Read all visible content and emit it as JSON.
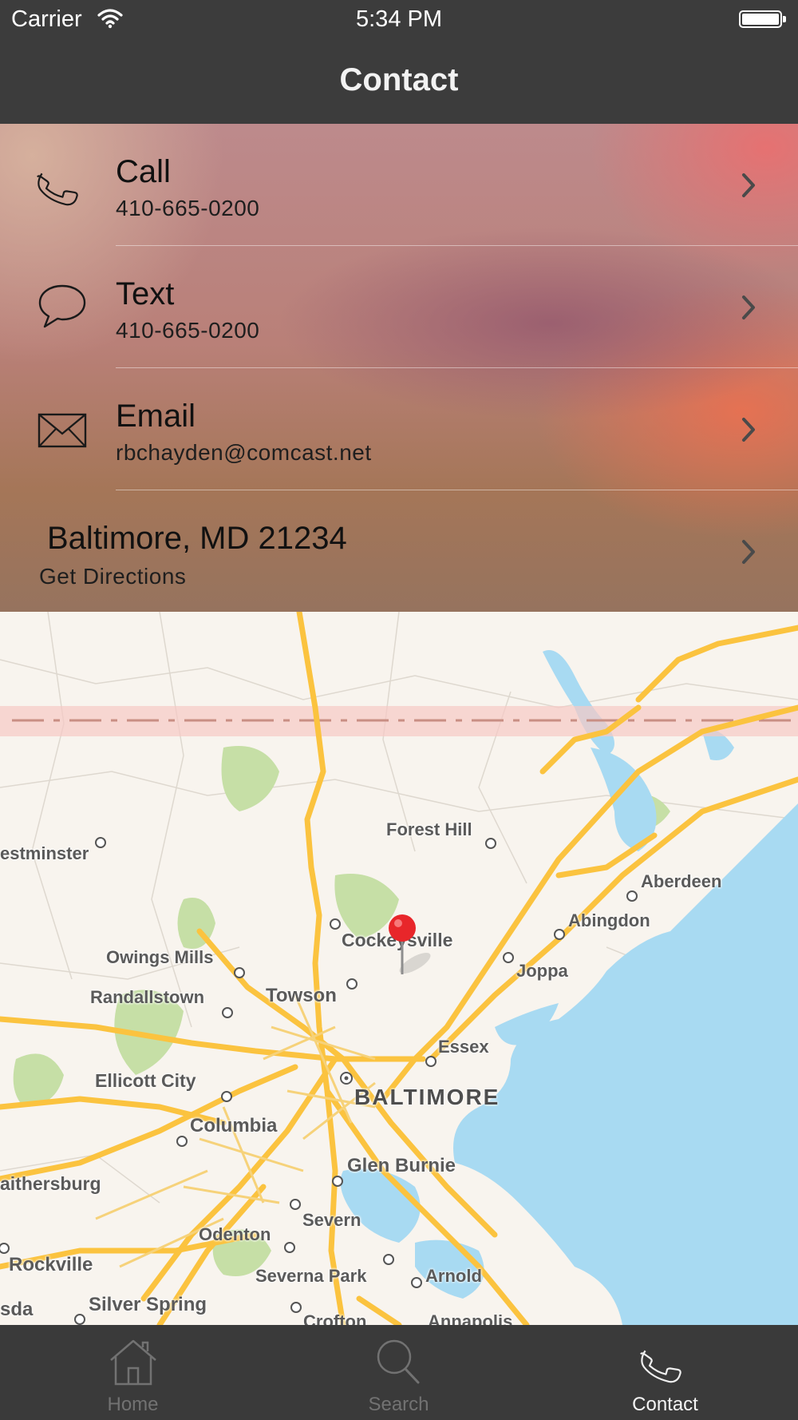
{
  "status_bar": {
    "carrier": "Carrier",
    "time": "5:34 PM"
  },
  "nav": {
    "title": "Contact"
  },
  "contact": {
    "call": {
      "title": "Call",
      "subtitle": "410-665-0200",
      "icon": "phone-icon"
    },
    "text": {
      "title": "Text",
      "subtitle": "410-665-0200",
      "icon": "speech-bubble-icon"
    },
    "email": {
      "title": "Email",
      "subtitle": "rbchayden@comcast.net",
      "icon": "envelope-icon"
    },
    "address": {
      "title": "Baltimore, MD 21234",
      "subtitle": "Get Directions"
    }
  },
  "map": {
    "labels": {
      "forest_hill": "Forest Hill",
      "westminster": "estminster",
      "aberdeen": "Aberdeen",
      "abingdon": "Abingdon",
      "owings_mills": "Owings Mills",
      "cockeysville": "Cockeysville",
      "joppa": "Joppa",
      "randallstown": "Randallstown",
      "towson": "Towson",
      "essex": "Essex",
      "ellicott_city": "Ellicott City",
      "baltimore": "BALTIMORE",
      "columbia": "Columbia",
      "glen_burnie": "Glen Burnie",
      "gaithersburg": "aithersburg",
      "odenton": "Odenton",
      "severn": "Severn",
      "rockville": "Rockville",
      "severna_park": "Severna Park",
      "arnold": "Arnold",
      "silver_spring": "Silver Spring",
      "bethesda": "sda",
      "crofton": "Crofton",
      "annapolis": "Annapolis"
    },
    "pin_color": "#e8262a",
    "water_color": "#a8daf2",
    "road_color": "#fbc33f",
    "park_color": "#c6dfa6"
  },
  "tabs": [
    {
      "label": "Home",
      "icon": "house-icon",
      "active": false
    },
    {
      "label": "Search",
      "icon": "magnifier-icon",
      "active": false
    },
    {
      "label": "Contact",
      "icon": "phone-icon",
      "active": true
    }
  ]
}
